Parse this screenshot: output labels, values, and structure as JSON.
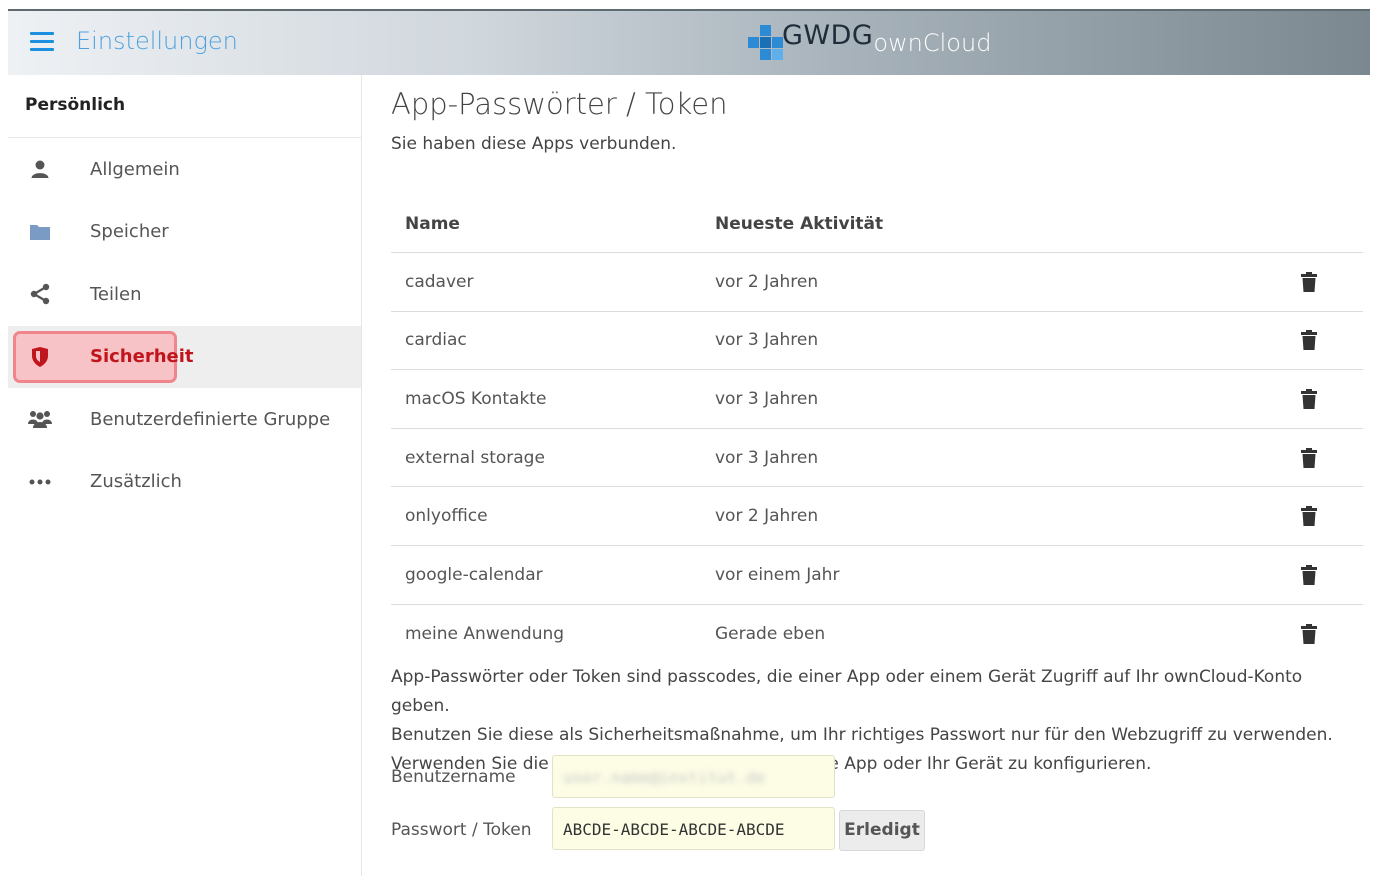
{
  "header": {
    "app_title": "Einstellungen",
    "logo_primary": "GWDG",
    "logo_secondary": "ownCloud"
  },
  "sidebar": {
    "heading": "Persönlich",
    "items": [
      {
        "label": "Allgemein",
        "icon": "user-icon"
      },
      {
        "label": "Speicher",
        "icon": "folder-icon"
      },
      {
        "label": "Teilen",
        "icon": "share-icon"
      },
      {
        "label": "Sicherheit",
        "icon": "shield-icon",
        "active": true
      },
      {
        "label": "Benutzerdefinierte Gruppe",
        "icon": "group-icon"
      },
      {
        "label": "Zusätzlich",
        "icon": "more-icon"
      }
    ]
  },
  "main": {
    "title": "App-Passwörter / Token",
    "subtitle": "Sie haben diese Apps verbunden.",
    "table": {
      "headers": [
        "Name",
        "Neueste Aktivität"
      ],
      "rows": [
        {
          "name": "cadaver",
          "activity": "vor 2 Jahren"
        },
        {
          "name": "cardiac",
          "activity": "vor 3 Jahren"
        },
        {
          "name": "macOS Kontakte",
          "activity": "vor 3 Jahren"
        },
        {
          "name": "external storage",
          "activity": "vor 3 Jahren"
        },
        {
          "name": "onlyoffice",
          "activity": "vor 2 Jahren"
        },
        {
          "name": "google-calendar",
          "activity": "vor einem Jahr"
        },
        {
          "name": "meine Anwendung",
          "activity": "Gerade eben"
        }
      ]
    },
    "info_lines": [
      "App-Passwörter oder Token sind passcodes, die einer App oder einem Gerät Zugriff auf Ihr ownCloud-Konto geben.",
      "Benutzen Sie diese als Sicherheitsmaßnahme, um Ihr richtiges Passwort nur für den Webzugriff zu verwenden.",
      "Verwenden Sie die folgenden Zugangsdaten um Ihre App oder Ihr Gerät zu konfigurieren."
    ],
    "username_label": "Benutzername",
    "username_value": "user.name@institut.de",
    "token_label": "Passwort / Token",
    "token_value": "ABCDE-ABCDE-ABCDE-ABCDE",
    "done_label": "Erledigt"
  },
  "colors": {
    "accent": "#1d8fe0",
    "active_text": "#c0151c",
    "active_highlight": "#f7c3c6"
  }
}
